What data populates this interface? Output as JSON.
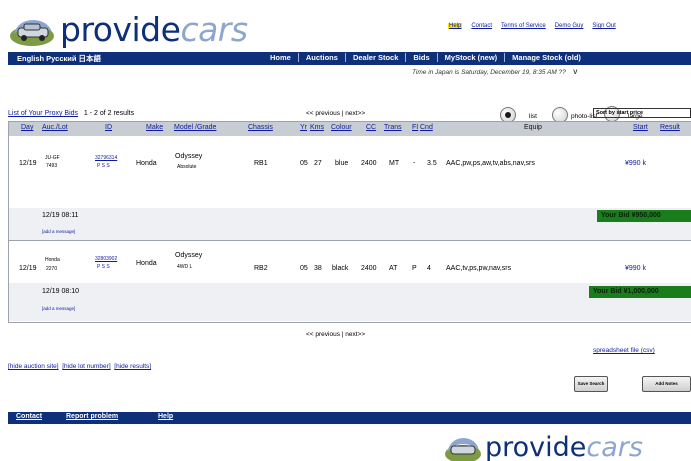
{
  "brand": {
    "name_a": "provide",
    "name_b": "cars"
  },
  "top_links": [
    "Help",
    "Contact",
    "Terms of Service",
    "Demo Guy",
    "Sign Out"
  ],
  "lang_bar": "English  Русский  日本語",
  "nav": [
    "Home",
    "Auctions",
    "Dealer Stock",
    "Bids",
    "MyStock (new)",
    "Manage Stock (old)"
  ],
  "time_note": "Time in Japan is Saturday, December 19, 8:35 AM ??",
  "time_note_tail": "V",
  "view_options": {
    "list": "list",
    "photo_list": "photo-list",
    "large": "large",
    "sort_select": "Sort by start price"
  },
  "list": {
    "title": "List of Your Proxy Bids",
    "count": "1 - 2 of 2 results"
  },
  "pager": {
    "prev": "<< previous",
    "sep": "|",
    "next": "next>>"
  },
  "columns": [
    "Day",
    "Auc./Lot",
    "ID",
    "Make",
    "Model /Grade",
    "Chassis",
    "Yr",
    "Kms",
    "Colour",
    "CC",
    "Trans",
    "FI",
    "Cnd",
    "Equip",
    "Start",
    "Result"
  ],
  "rows": [
    {
      "day": "12/19",
      "auc": "JU-GF",
      "lot": "7493",
      "id": "32796314",
      "id_sub": "P  S  S",
      "make": "Honda",
      "model": "Odyssey",
      "grade": "Absolute",
      "chassis": "RB1",
      "yr": "05",
      "kms": "27",
      "colour": "blue",
      "cc": "2400",
      "trans": "MT",
      "fi": "-",
      "cnd": "3.5",
      "equip": "AAC,pw,ps,aw,tv,abs,nav,srs",
      "start": "¥990 k",
      "bid_time": "12/19 08:11",
      "add_msg": "[add a message]",
      "your_bid": "Your Bid ¥950,000"
    },
    {
      "day": "12/19",
      "auc": "Honda",
      "lot": "2270",
      "id": "32803902",
      "id_sub": "P  S  S",
      "make": "Honda",
      "model": "Odyssey",
      "grade": "4WD L",
      "chassis": "RB2",
      "yr": "05",
      "kms": "38",
      "colour": "black",
      "cc": "2400",
      "trans": "AT",
      "fi": "P",
      "cnd": "4",
      "equip": "AAC,tv,ps,pw,nav,srs",
      "start": "¥990 k",
      "bid_time": "12/19 08:10",
      "add_msg": "[add a message]",
      "your_bid": "Your Bid ¥1,000,000"
    }
  ],
  "bottom_links": [
    "[hide auction site]",
    "[hide lot number]",
    "[hide results]"
  ],
  "spreadsheet": "spreadsheet file (csv)",
  "buttons": [
    "Save Search",
    "Add Notes"
  ],
  "footer": [
    "Contact",
    "Report problem",
    "Help"
  ],
  "colors": {
    "brand_navy": "#0e2f7a",
    "brand_light": "#8da6cf",
    "bid_green": "#197d1c",
    "help_yellow": "#ffe400"
  }
}
